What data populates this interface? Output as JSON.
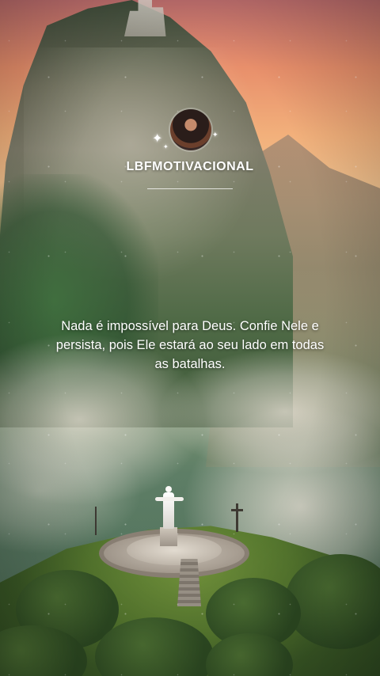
{
  "profile": {
    "username": "LBFMOTIVACIONAL",
    "avatar_icon": "avatar-portrait",
    "sparkle_icon": "sparkle-icon"
  },
  "post": {
    "quote": "Nada é impossível para Deus. Confie Nele e persista, pois Ele estará ao seu lado em todas as batalhas."
  },
  "colors": {
    "text": "#ffffff",
    "sky_top": "#b86a6a",
    "sky_glow": "#f2b07b",
    "foliage": "#55772e"
  }
}
